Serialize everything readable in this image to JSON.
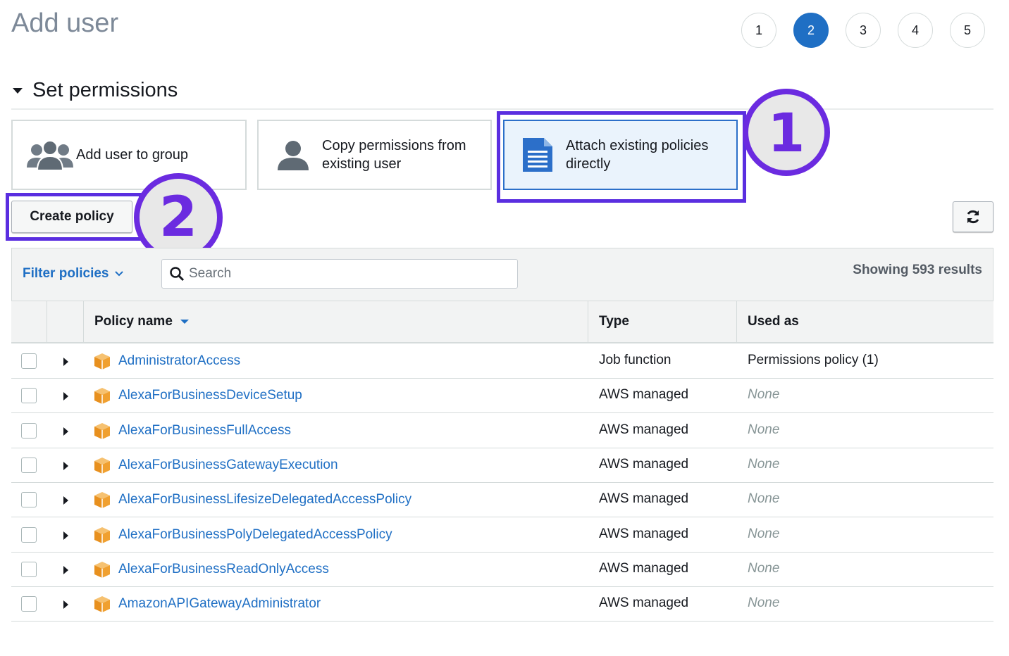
{
  "page": {
    "title": "Add user"
  },
  "steps": [
    "1",
    "2",
    "3",
    "4",
    "5"
  ],
  "active_step": "2",
  "section": {
    "title": "Set permissions"
  },
  "options": [
    {
      "label": "Add user to group",
      "icon": "users-group-icon"
    },
    {
      "label_line1": "Copy permissions from",
      "label_line2": "existing user",
      "icon": "user-icon"
    },
    {
      "label_line1": "Attach existing policies",
      "label_line2": "directly",
      "icon": "document-icon"
    }
  ],
  "badges": {
    "first": "1",
    "second": "2"
  },
  "toolbar": {
    "create_policy": "Create policy",
    "refresh_icon": "refresh-icon"
  },
  "filter": {
    "label": "Filter policies",
    "search_placeholder": "Search",
    "results": "Showing 593 results"
  },
  "table": {
    "columns": {
      "name": "Policy name",
      "type": "Type",
      "used_as": "Used as"
    },
    "rows": [
      {
        "name": "AdministratorAccess",
        "type": "Job function",
        "used_as": "Permissions policy (1)"
      },
      {
        "name": "AlexaForBusinessDeviceSetup",
        "type": "AWS managed",
        "used_as": "None"
      },
      {
        "name": "AlexaForBusinessFullAccess",
        "type": "AWS managed",
        "used_as": "None"
      },
      {
        "name": "AlexaForBusinessGatewayExecution",
        "type": "AWS managed",
        "used_as": "None"
      },
      {
        "name": "AlexaForBusinessLifesizeDelegatedAccessPolicy",
        "type": "AWS managed",
        "used_as": "None"
      },
      {
        "name": "AlexaForBusinessPolyDelegatedAccessPolicy",
        "type": "AWS managed",
        "used_as": "None"
      },
      {
        "name": "AlexaForBusinessReadOnlyAccess",
        "type": "AWS managed",
        "used_as": "None"
      },
      {
        "name": "AmazonAPIGatewayAdministrator",
        "type": "AWS managed",
        "used_as": "None"
      }
    ]
  },
  "colors": {
    "accent": "#1f6fc4",
    "highlight": "#5a2ee0",
    "policy_icon": "#f0a030"
  }
}
